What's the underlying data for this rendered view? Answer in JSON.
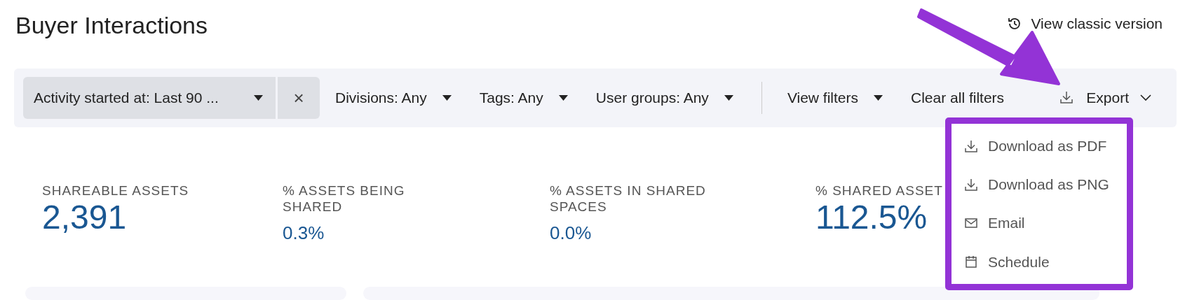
{
  "page": {
    "title": "Buyer Interactions",
    "classic_link": "View classic version"
  },
  "filters": [
    {
      "kind": "chip",
      "label": "Activity started at: Last 90 ...",
      "clear": "×"
    },
    {
      "kind": "dropdown",
      "label": "Divisions: Any"
    },
    {
      "kind": "dropdown",
      "label": "Tags: Any"
    },
    {
      "kind": "dropdown",
      "label": "User groups: Any"
    },
    {
      "kind": "divider"
    },
    {
      "kind": "dropdown",
      "label": "View filters"
    },
    {
      "kind": "link",
      "label": "Clear all filters"
    }
  ],
  "export": {
    "label": "Export",
    "expanded": true,
    "menu": [
      {
        "kind": "download",
        "label": "Download as PDF"
      },
      {
        "kind": "download",
        "label": "Download as PNG"
      },
      {
        "kind": "email",
        "label": "Email"
      },
      {
        "kind": "schedule",
        "label": "Schedule"
      }
    ]
  },
  "metrics": [
    {
      "label": "SHAREABLE ASSETS",
      "value": "2,391",
      "highlighted": true
    },
    {
      "label": "% ASSETS BEING SHARED",
      "value": "0.3%",
      "highlighted": false
    },
    {
      "label": "% ASSETS IN SHARED SPACES",
      "value": "0.0%",
      "highlighted": false
    },
    {
      "label": "% SHARED ASSET",
      "value": "112.5%",
      "highlighted": true
    }
  ],
  "annotation": {
    "kind": "arrow",
    "color": "#9333d6"
  }
}
